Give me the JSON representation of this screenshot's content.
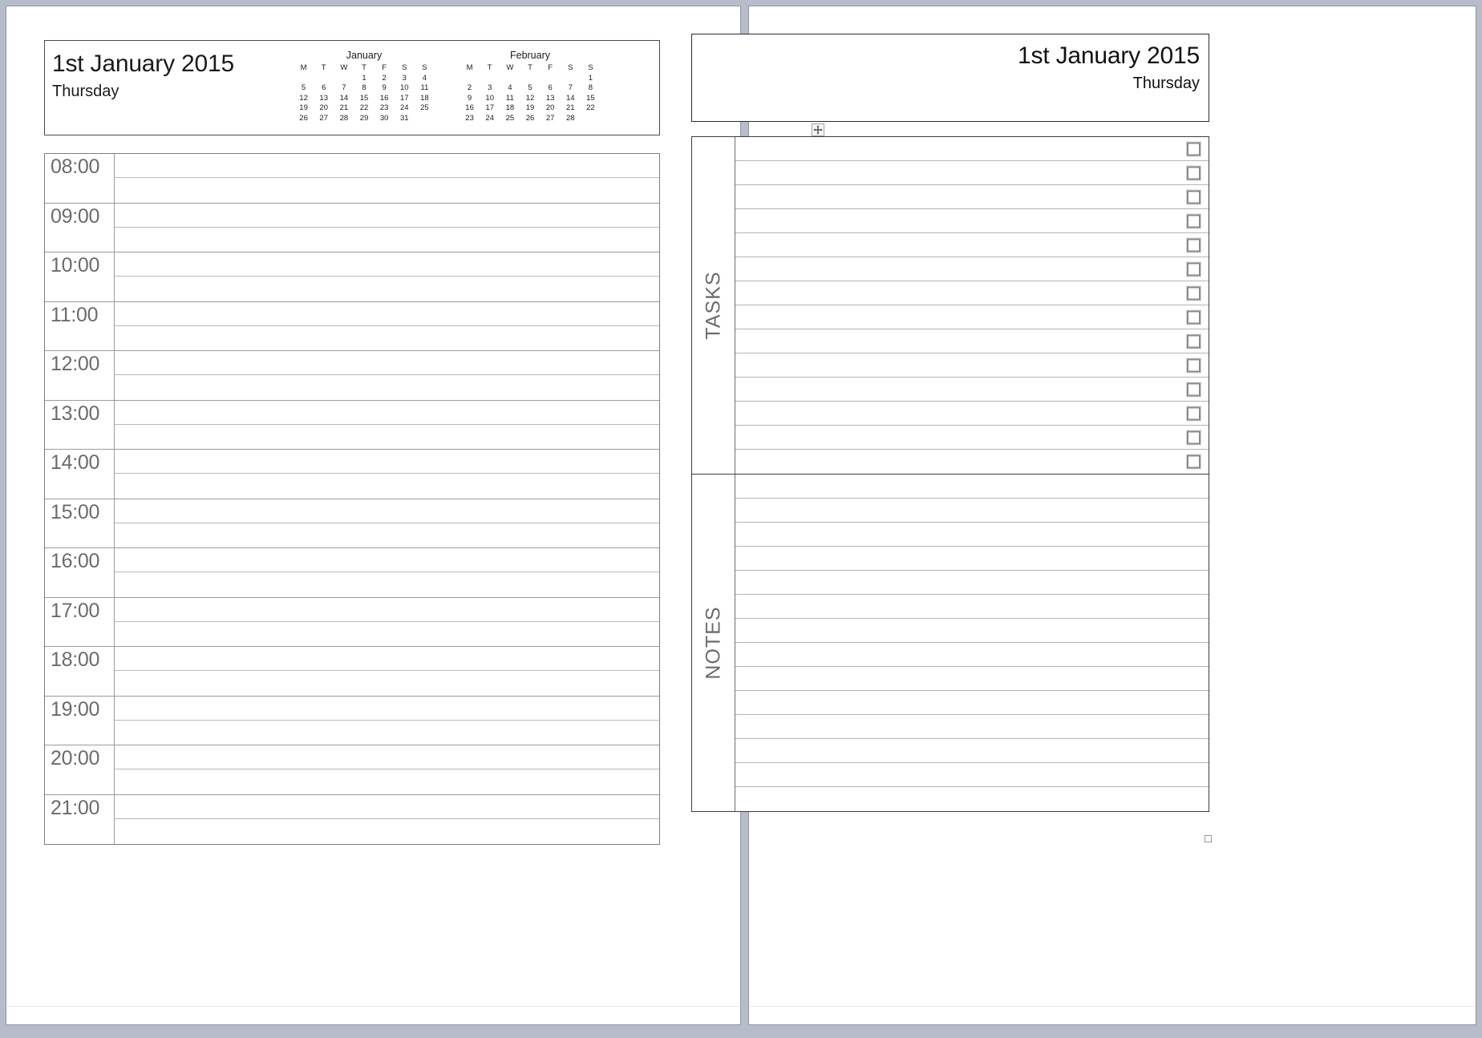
{
  "document": {
    "app_view": "print-layout-two-page-spread",
    "background_color": "#b6bcc9"
  },
  "left_page": {
    "header": {
      "date_title": "1st January 2015",
      "weekday": "Thursday"
    },
    "mini_calendars": [
      {
        "name": "January",
        "weekday_headers": [
          "M",
          "T",
          "W",
          "T",
          "F",
          "S",
          "S"
        ],
        "weeks": [
          [
            "",
            "",
            "",
            "1",
            "2",
            "3",
            "4"
          ],
          [
            "5",
            "6",
            "7",
            "8",
            "9",
            "10",
            "11"
          ],
          [
            "12",
            "13",
            "14",
            "15",
            "16",
            "17",
            "18"
          ],
          [
            "19",
            "20",
            "21",
            "22",
            "23",
            "24",
            "25"
          ],
          [
            "26",
            "27",
            "28",
            "29",
            "30",
            "31",
            ""
          ]
        ]
      },
      {
        "name": "February",
        "weekday_headers": [
          "M",
          "T",
          "W",
          "T",
          "F",
          "S",
          "S"
        ],
        "weeks": [
          [
            "",
            "",
            "",
            "",
            "",
            "",
            "1"
          ],
          [
            "2",
            "3",
            "4",
            "5",
            "6",
            "7",
            "8"
          ],
          [
            "9",
            "10",
            "11",
            "12",
            "13",
            "14",
            "15"
          ],
          [
            "16",
            "17",
            "18",
            "19",
            "20",
            "21",
            "22"
          ],
          [
            "23",
            "24",
            "25",
            "26",
            "27",
            "28",
            ""
          ]
        ]
      }
    ],
    "schedule": {
      "hours": [
        "08:00",
        "09:00",
        "10:00",
        "11:00",
        "12:00",
        "13:00",
        "14:00",
        "15:00",
        "16:00",
        "17:00",
        "18:00",
        "19:00",
        "20:00",
        "21:00"
      ],
      "slots_per_hour": 2
    }
  },
  "right_page": {
    "header": {
      "date_title": "1st January 2015",
      "weekday": "Thursday"
    },
    "table_handle_icon": "move-cross-icon",
    "tasks": {
      "legend": "TASKS",
      "row_count": 14,
      "checkbox_icon": "empty-checkbox-icon"
    },
    "notes": {
      "legend": "NOTES",
      "row_count": 14
    }
  },
  "colors": {
    "workspace": "#b6bcc9",
    "page": "#ffffff",
    "hour_label_text": "#6b6b6b",
    "legend_text": "#6b6b6b",
    "grid_line": "#b4b4b4",
    "border_dark": "#3c3c3c",
    "checkbox_border": "#8a8a8a"
  }
}
